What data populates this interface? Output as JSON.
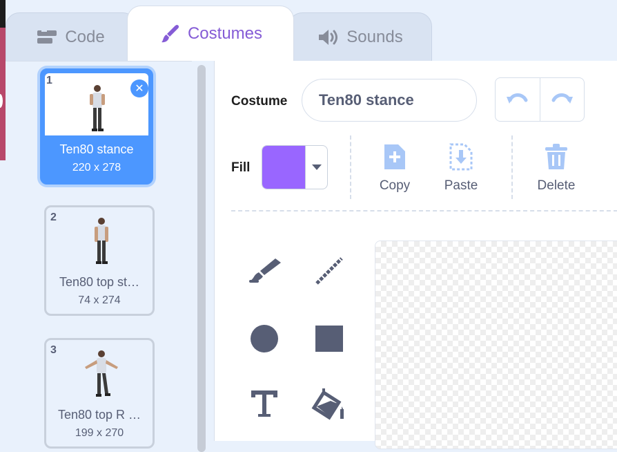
{
  "tabs": {
    "code": {
      "label": "Code",
      "icon": "code-icon"
    },
    "costumes": {
      "label": "Costumes",
      "icon": "brush-icon"
    },
    "sounds": {
      "label": "Sounds",
      "icon": "speaker-icon"
    }
  },
  "costumes": [
    {
      "number": "1",
      "name": "Ten80 stance",
      "size": "220 x 278",
      "selected": true
    },
    {
      "number": "2",
      "name": "Ten80 top st…",
      "size": "74 x 274",
      "selected": false
    },
    {
      "number": "3",
      "name": "Ten80 top R …",
      "size": "199 x 270",
      "selected": false
    }
  ],
  "editor": {
    "costume_label": "Costume",
    "costume_name": "Ten80 stance",
    "fill_label": "Fill",
    "fill_color": "#9966ff",
    "actions": {
      "copy": "Copy",
      "paste": "Paste",
      "delete": "Delete"
    }
  },
  "colors": {
    "accent_purple": "#855cd6",
    "selection_blue": "#4c97ff",
    "icon_gray": "#575e75"
  },
  "tools": [
    "brush-icon",
    "line-icon",
    "circle-icon",
    "rectangle-icon",
    "text-icon",
    "fill-bucket-icon"
  ]
}
